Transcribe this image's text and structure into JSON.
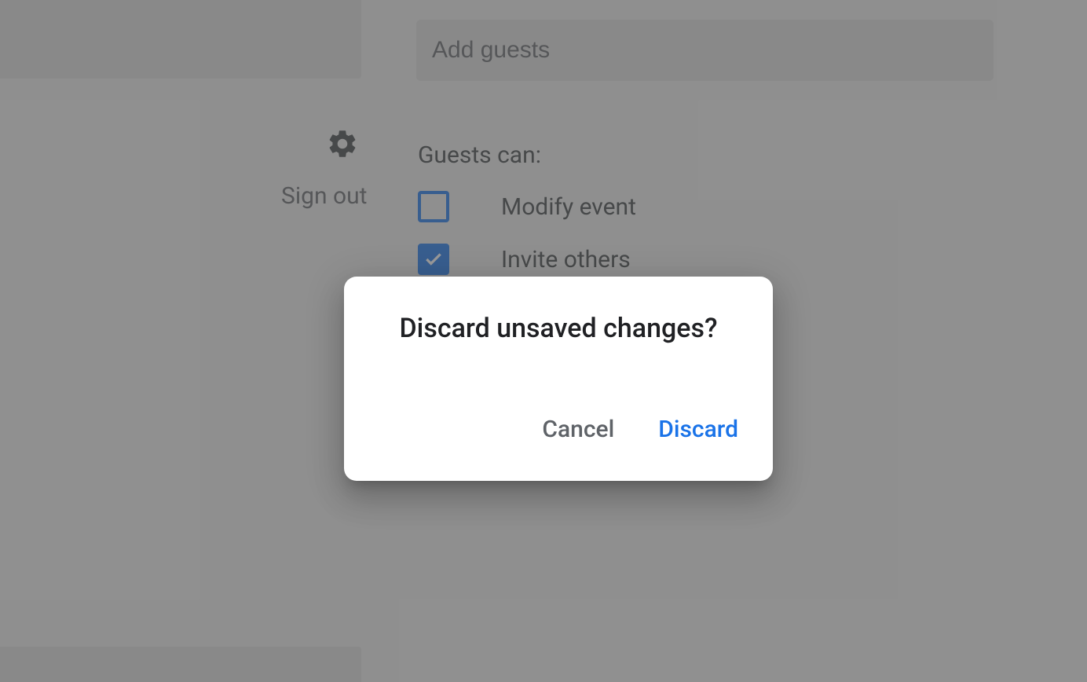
{
  "guests": {
    "input_placeholder": "Add guests",
    "permissions_heading": "Guests can:",
    "options": [
      {
        "label": "Modify event",
        "checked": false
      },
      {
        "label": "Invite others",
        "checked": true
      }
    ]
  },
  "sidebar": {
    "sign_out_label": "Sign out"
  },
  "dialog": {
    "title": "Discard unsaved changes?",
    "cancel_label": "Cancel",
    "confirm_label": "Discard"
  },
  "colors": {
    "primary": "#1a73e8",
    "text_primary": "#202124",
    "text_secondary": "#5f6368"
  }
}
